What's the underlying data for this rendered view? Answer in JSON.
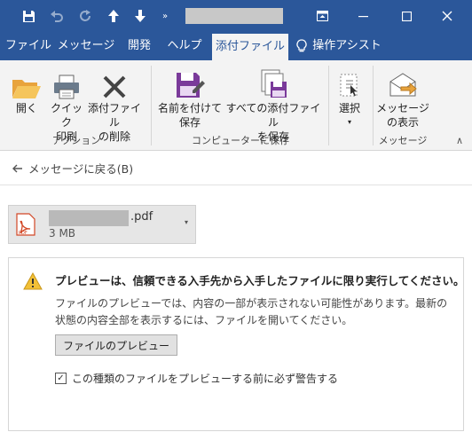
{
  "tabs": [
    {
      "label": "ファイル"
    },
    {
      "label": "メッセージ"
    },
    {
      "label": "開発"
    },
    {
      "label": "ヘルプ"
    },
    {
      "label": "添付ファイル"
    },
    {
      "label": "操作アシスト"
    }
  ],
  "ribbon": {
    "open": [
      "開く"
    ],
    "quick_print": [
      "クイック",
      "印刷"
    ],
    "delete_attachment": [
      "添付ファイル",
      "の削除"
    ],
    "group_actions": "アクション",
    "save_as": [
      "名前を付けて",
      "保存"
    ],
    "save_all": [
      "すべての添付ファイル",
      "を保存"
    ],
    "group_save": "コンピューターに保存",
    "select": [
      "選択"
    ],
    "show_message": [
      "メッセージ",
      "の表示"
    ],
    "group_message": "メッセージ"
  },
  "back_link": "メッセージに戻る(B)",
  "attachment": {
    "name_ext": ".pdf",
    "size": "3 MB",
    "icon_label": "PDF"
  },
  "notice": {
    "title": "プレビューは、信頼できる入手先から入手したファイルに限り実行してください。",
    "body": "ファイルのプレビューでは、内容の一部が表示されない可能性があります。最新の状態の内容全部を表示するには、ファイルを開いてください。",
    "preview_button": "ファイルのプレビュー",
    "checkbox_label": "この種類のファイルをプレビューする前に必ず警告する",
    "checkbox_checked": true
  },
  "colors": {
    "title_bar": "#2b579a",
    "ribbon_bg": "#f3f3f3",
    "accent": "#2b579a"
  }
}
